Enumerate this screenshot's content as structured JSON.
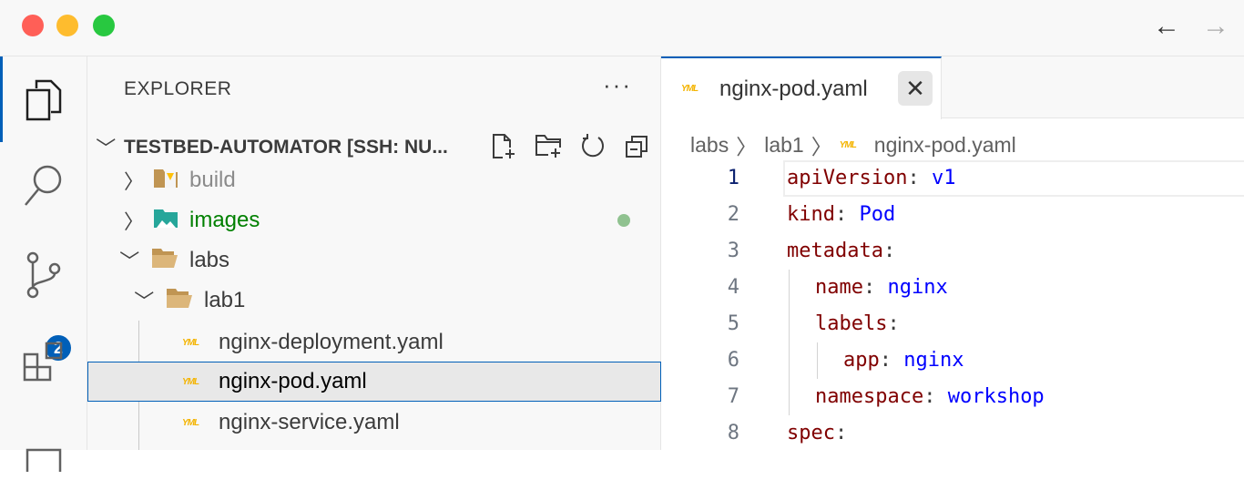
{
  "window": {
    "back_icon": "arrow-left",
    "forward_icon": "arrow-right"
  },
  "activity_bar": {
    "items": [
      "explorer",
      "search",
      "source-control",
      "extensions",
      "remote"
    ],
    "scm_badge": "2"
  },
  "sidebar": {
    "title": "EXPLORER",
    "more": "···",
    "root": "TESTBED-AUTOMATOR [SSH: NU...",
    "tree": [
      {
        "label": "build",
        "type": "folder",
        "expanded": false,
        "color": "#8b8b8b"
      },
      {
        "label": "images",
        "type": "folder",
        "expanded": false,
        "color": "#008000",
        "modified": true
      },
      {
        "label": "labs",
        "type": "folder",
        "expanded": true,
        "color": "#3b3b3b"
      },
      {
        "label": "lab1",
        "type": "folder",
        "expanded": true,
        "color": "#3b3b3b"
      },
      {
        "label": "nginx-deployment.yaml",
        "type": "file",
        "color": "#3b3b3b"
      },
      {
        "label": "nginx-pod.yaml",
        "type": "file",
        "selected": true,
        "color": "#000000"
      },
      {
        "label": "nginx-service.yaml",
        "type": "file",
        "color": "#3b3b3b"
      }
    ],
    "file_icon_text": "YML"
  },
  "editor": {
    "tab": {
      "label": "nginx-pod.yaml",
      "close": "✕"
    },
    "breadcrumbs": [
      "labs",
      "lab1",
      "nginx-pod.yaml"
    ],
    "lines": [
      {
        "n": "1",
        "indent": 0,
        "key": "apiVersion",
        "val": "v1"
      },
      {
        "n": "2",
        "indent": 0,
        "key": "kind",
        "val": "Pod"
      },
      {
        "n": "3",
        "indent": 0,
        "key": "metadata",
        "val": ""
      },
      {
        "n": "4",
        "indent": 1,
        "key": "name",
        "val": "nginx"
      },
      {
        "n": "5",
        "indent": 1,
        "key": "labels",
        "val": ""
      },
      {
        "n": "6",
        "indent": 2,
        "key": "app",
        "val": "nginx"
      },
      {
        "n": "7",
        "indent": 1,
        "key": "namespace",
        "val": "workshop"
      },
      {
        "n": "8",
        "indent": 0,
        "key": "spec",
        "val": ""
      }
    ]
  }
}
